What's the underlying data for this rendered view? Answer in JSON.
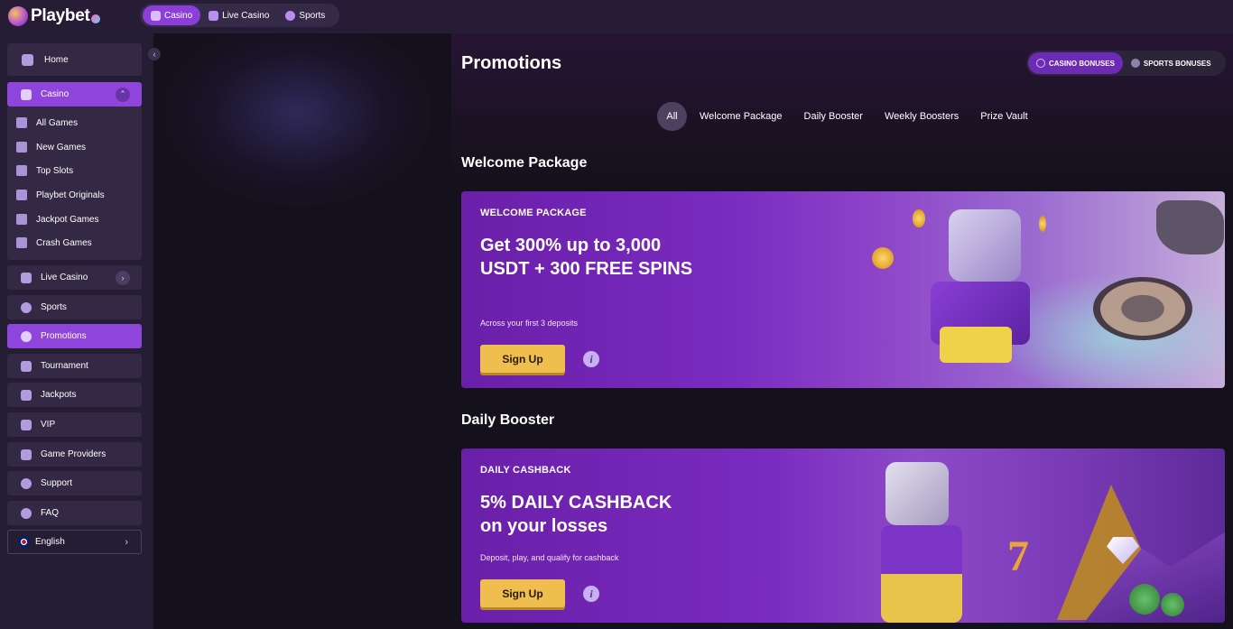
{
  "brand": {
    "name": "Playbet"
  },
  "topnav": [
    {
      "label": "Casino",
      "icon": "casino-icon",
      "active": true
    },
    {
      "label": "Live Casino",
      "icon": "dealer-icon",
      "active": false
    },
    {
      "label": "Sports",
      "icon": "ball-icon",
      "active": false
    }
  ],
  "sidebar": {
    "home": "Home",
    "casino": "Casino",
    "casino_sub": [
      "All Games",
      "New Games",
      "Top Slots",
      "Playbet Originals",
      "Jackpot Games",
      "Crash Games"
    ],
    "live_casino": "Live Casino",
    "sports": "Sports",
    "promotions": "Promotions",
    "tournament": "Tournament",
    "jackpots": "Jackpots",
    "vip": "VIP",
    "game_providers": "Game Providers",
    "support": "Support",
    "faq": "FAQ",
    "language": "English"
  },
  "main": {
    "title": "Promotions",
    "bonus_tabs": {
      "casino": "CASINO BONUSES",
      "sports": "SPORTS BONUSES"
    },
    "filters": [
      "All",
      "Welcome Package",
      "Daily Booster",
      "Weekly Boosters",
      "Prize Vault"
    ],
    "sections": [
      {
        "title": "Welcome Package",
        "eyebrow": "WELCOME PACKAGE",
        "headline": "Get 300% up to 3,000 USDT + 300 FREE SPINS",
        "sub": "Across your first 3 deposits",
        "button": "Sign Up",
        "info": "i"
      },
      {
        "title": "Daily Booster",
        "eyebrow": "DAILY CASHBACK",
        "headline": "5% DAILY CASHBACK on your losses",
        "sub": "Deposit, play, and qualify for cashback",
        "button": "Sign Up",
        "info": "i"
      }
    ]
  },
  "colors": {
    "accent": "#8f45dc",
    "button": "#f0bd4f",
    "background": "#15111c",
    "sidebar": "#251d33"
  }
}
